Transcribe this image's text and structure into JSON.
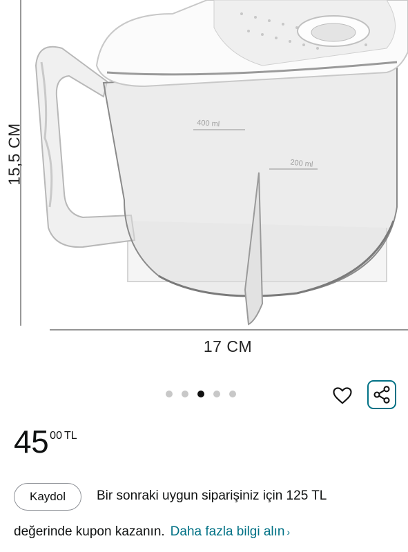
{
  "product_image": {
    "height_label": "15,5 CM",
    "width_label": "17 CM",
    "marking_400": "400 ml",
    "marking_200": "200 ml"
  },
  "carousel": {
    "count": 5,
    "active_index": 2
  },
  "actions": {
    "wishlist_icon": "heart-icon",
    "share_icon": "share-icon",
    "accent_color": "#007185"
  },
  "price": {
    "whole": "45",
    "fraction": "00",
    "currency": "TL"
  },
  "coupon": {
    "button_label": "Kaydol",
    "line1": "Bir sonraki uygun siparişiniz için 125 TL",
    "line2": "değerinde kupon kazanın.",
    "more_link": "Daha fazla bilgi alın",
    "chevron": "›"
  }
}
